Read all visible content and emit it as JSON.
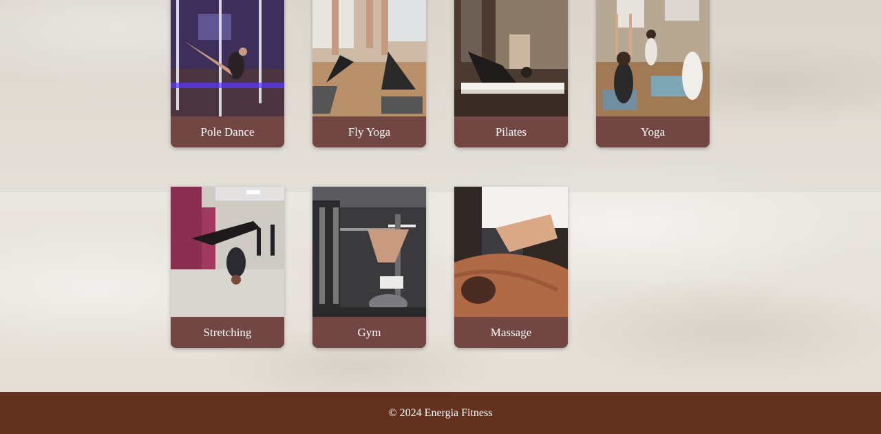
{
  "classes": {
    "row1": [
      {
        "label": "Pole Dance",
        "image_icon": "pole-dance-photo"
      },
      {
        "label": "Fly Yoga",
        "image_icon": "fly-yoga-photo"
      },
      {
        "label": "Pilates",
        "image_icon": "pilates-photo"
      },
      {
        "label": "Yoga",
        "image_icon": "yoga-photo"
      }
    ],
    "row2": [
      {
        "label": "Stretching",
        "image_icon": "stretching-photo"
      },
      {
        "label": "Gym",
        "image_icon": "gym-photo"
      },
      {
        "label": "Massage",
        "image_icon": "massage-photo"
      }
    ]
  },
  "footer": {
    "text": "© 2024 Energia Fitness"
  },
  "colors": {
    "card_label_bg": "#714643",
    "footer_bg": "#63321f",
    "page_bg": "#e6e1da"
  }
}
